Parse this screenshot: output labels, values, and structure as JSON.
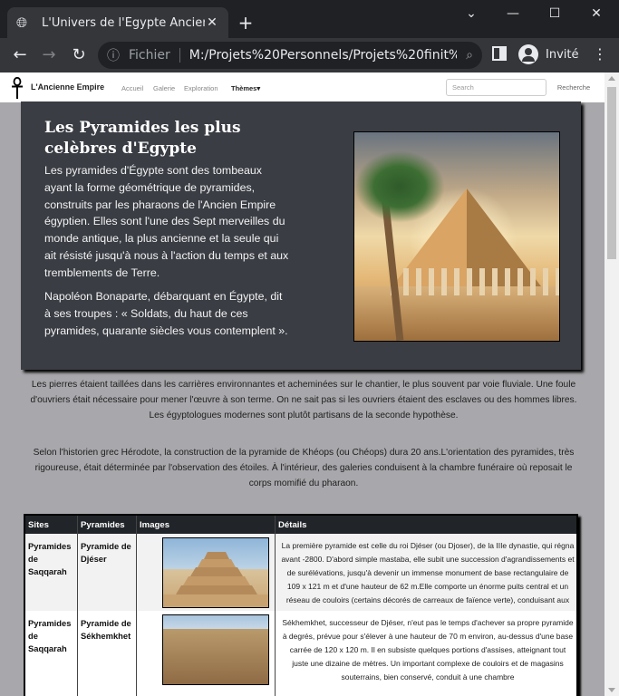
{
  "browser": {
    "tab_title": "L'Univers de l'Égypte Ancienne",
    "tab_icon": "globe-icon",
    "new_tab": "+",
    "scheme": "Fichier",
    "url": "M:/Projets%20Personnels/Projets%20finit%20...",
    "profile_label": "Invité"
  },
  "site_nav": {
    "brand": "L'Ancienne Empire",
    "links": [
      "Accueil",
      "Galerie",
      "Exploration"
    ],
    "dropdown": "Thèmes",
    "search_placeholder": "Search",
    "search_button": "Recherche"
  },
  "hero": {
    "title": "Les Pyramides les plus celèbres d'Egypte",
    "paragraph1": "Les pyramides d'Égypte sont des tombeaux ayant la forme géométrique de pyramides, construits par les pharaons de l'Ancien Empire égyptien. Elles sont l'une des Sept merveilles du monde antique, la plus ancienne et la seule qui ait résisté jusqu'à nous à l'action du temps et aux tremblements de Terre.",
    "paragraph2": "Napoléon Bonaparte, débarquant en Égypte, dit à ses troupes : « Soldats, du haut de ces pyramides, quarante siècles vous contemplent »."
  },
  "body": {
    "paragraph1": "Les pierres étaient taillées dans les carrières environnantes et acheminées sur le chantier, le plus souvent par voie fluviale. Une foule d'ouvriers était nécessaire pour mener l'œuvre à son terme. On ne sait pas si les ouvriers étaient des esclaves ou des hommes libres. Les égyptologues modernes sont plutôt partisans de la seconde hypothèse.",
    "paragraph2": "Selon l'historien grec Hérodote, la construction de la pyramide de Khéops (ou Chéops) dura 20 ans.L'orientation des pyramides, très rigoureuse, était déterminée par l'observation des étoiles. À l'intérieur, des galeries conduisent à la chambre funéraire où reposait le corps momifié du pharaon."
  },
  "table": {
    "headers": [
      "Sites",
      "Pyramides",
      "Images",
      "Détails"
    ],
    "rows": [
      {
        "site": "Pyramides de Saqqarah",
        "pyramide": "Pyramide de Djéser",
        "details": "La première pyramide est celle du roi Djéser (ou Djoser), de la IIIe dynastie, qui régna avant -2800. D'abord simple mastaba, elle subit une succession d'agrandissements et de surélévations, jusqu'à devenir un immense monument de base rectangulaire de 109 x 121 m et d'une hauteur de 62 m.Elle comporte un énorme puits central et un réseau de couloirs (certains décorés de carreaux de faïence verte), conduisant aux chambres et magasins funéraires."
      },
      {
        "site": "Pyramides de Saqqarah",
        "pyramide": "Pyramide de Sékhemkhet",
        "details": "Sékhemkhet, successeur de Djéser, n'eut pas le temps d'achever sa propre pyramide à degrés, prévue pour s'élever à une hauteur de 70 m environ, au-dessus d'une base carrée de 120 x 120 m. Il en subsiste quelques portions d'assises, atteignant tout juste une dizaine de mètres. Un important complexe de couloirs et de magasins souterrains, bien conservé, conduit à une chambre"
      }
    ]
  }
}
